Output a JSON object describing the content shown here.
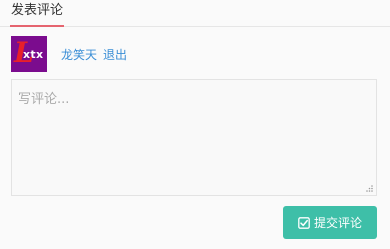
{
  "tabs": {
    "active_label": "发表评论"
  },
  "user": {
    "avatar_text": "xtx",
    "avatar_logo_letter": "L",
    "name": "龙笑天",
    "logout_label": "退出"
  },
  "comment": {
    "placeholder": "写评论...",
    "value": ""
  },
  "submit": {
    "label": "提交评论",
    "icon": "check-square-icon"
  },
  "colors": {
    "accent_underline": "#e5646f",
    "link": "#3a8ed6",
    "submit_bg": "#3ebfa8",
    "avatar_bg": "#7b0c8e"
  }
}
